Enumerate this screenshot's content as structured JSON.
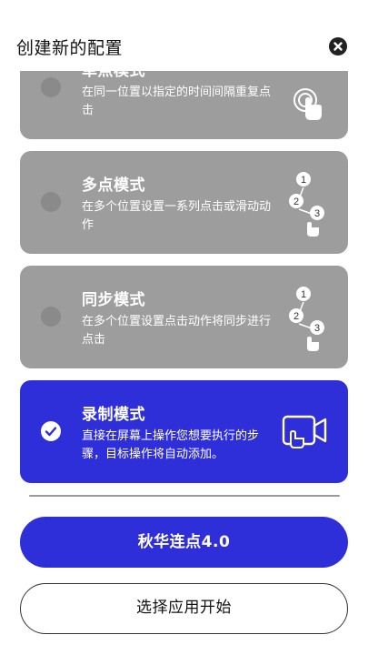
{
  "header": {
    "title": "创建新的配置"
  },
  "modes": [
    {
      "title": "单点模式",
      "description": "在同一位置以指定的时间间隔重复点击",
      "selected": false,
      "icon": "single-tap-icon"
    },
    {
      "title": "多点模式",
      "description": "在多个位置设置一系列点击或滑动动作",
      "selected": false,
      "icon": "multi-tap-icon",
      "badges": [
        "1",
        "2",
        "3"
      ]
    },
    {
      "title": "同步模式",
      "description": "在多个位置设置点击动作将同步进行点击",
      "selected": false,
      "icon": "sync-tap-icon",
      "badges": [
        "1",
        "2",
        "3"
      ]
    },
    {
      "title": "录制模式",
      "description": "直接在屏幕上操作您想要执行的步骤，目标操作将自动添加。",
      "selected": true,
      "icon": "record-screen-icon"
    }
  ],
  "buttons": {
    "primary": "秋华连点4.0",
    "secondary": "选择应用开始"
  },
  "colors": {
    "accent": "#2f2fd9",
    "card_inactive": "#9d9d9d"
  }
}
